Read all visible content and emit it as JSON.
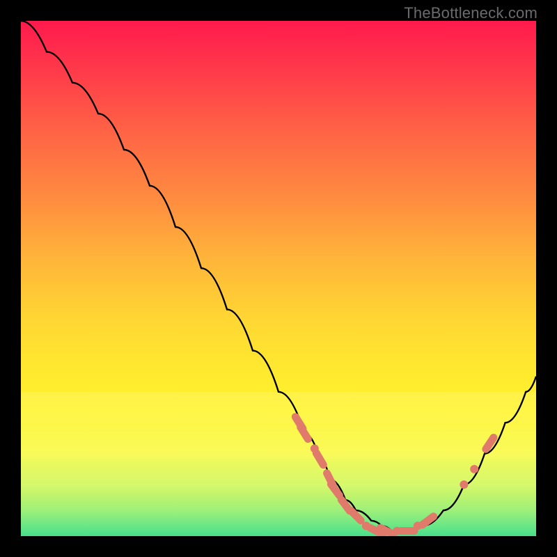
{
  "attribution": "TheBottleneck.com",
  "colors": {
    "page_bg": "#000000",
    "gradient_top": "#ff1a4d",
    "gradient_mid": "#ffd733",
    "gradient_bottom": "#47e08d",
    "curve": "#000000",
    "marker": "#e07a6a"
  },
  "chart_data": {
    "type": "line",
    "title": "",
    "xlabel": "",
    "ylabel": "",
    "xlim": [
      0,
      100
    ],
    "ylim": [
      0,
      100
    ],
    "grid": false,
    "series": [
      {
        "name": "bottleneck-curve",
        "x": [
          0,
          5,
          10,
          15,
          20,
          25,
          30,
          35,
          40,
          45,
          50,
          55,
          58,
          60,
          63,
          65,
          68,
          70,
          72,
          75,
          78,
          82,
          86,
          90,
          94,
          98,
          100
        ],
        "y": [
          100,
          94,
          88,
          82,
          75,
          68,
          60,
          52,
          44,
          36,
          28,
          20,
          15,
          11,
          7,
          5,
          3,
          2,
          1,
          1,
          2,
          5,
          10,
          16,
          22,
          28,
          31
        ]
      }
    ],
    "markers": [
      {
        "x": 54,
        "y": 22,
        "shape": "dash"
      },
      {
        "x": 55,
        "y": 20,
        "shape": "dash"
      },
      {
        "x": 57,
        "y": 17,
        "shape": "dot"
      },
      {
        "x": 58,
        "y": 15,
        "shape": "dash"
      },
      {
        "x": 60,
        "y": 11,
        "shape": "dash"
      },
      {
        "x": 61,
        "y": 9,
        "shape": "dash"
      },
      {
        "x": 63,
        "y": 6,
        "shape": "dash"
      },
      {
        "x": 65,
        "y": 4,
        "shape": "dash"
      },
      {
        "x": 67,
        "y": 2,
        "shape": "dot"
      },
      {
        "x": 69,
        "y": 1,
        "shape": "dash"
      },
      {
        "x": 71,
        "y": 1,
        "shape": "dash"
      },
      {
        "x": 73,
        "y": 1,
        "shape": "dot"
      },
      {
        "x": 75,
        "y": 1,
        "shape": "dash"
      },
      {
        "x": 77,
        "y": 2,
        "shape": "dot"
      },
      {
        "x": 79,
        "y": 3,
        "shape": "dash"
      },
      {
        "x": 86,
        "y": 10,
        "shape": "dot"
      },
      {
        "x": 88,
        "y": 13,
        "shape": "dot"
      },
      {
        "x": 91,
        "y": 18,
        "shape": "dash"
      }
    ]
  }
}
